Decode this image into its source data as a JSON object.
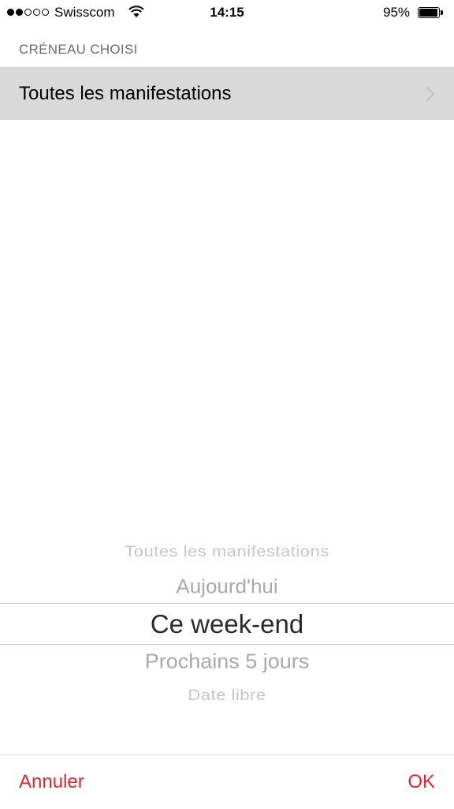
{
  "status_bar": {
    "carrier": "Swisscom",
    "time": "14:15",
    "battery": "95%",
    "signal_strength": 2,
    "signal_max": 5
  },
  "section": {
    "header": "CRÉNEAU CHOISI",
    "row_label": "Toutes les manifestations"
  },
  "picker": {
    "items": [
      "Toutes les manifestations",
      "Aujourd'hui",
      "Ce week-end",
      "Prochains 5 jours",
      "Date libre"
    ],
    "selected": "Ce week-end"
  },
  "toolbar": {
    "cancel_label": "Annuler",
    "ok_label": "OK"
  },
  "colors": {
    "accent": "#e4252b",
    "selected_row_bg": "#d9d9d9"
  }
}
